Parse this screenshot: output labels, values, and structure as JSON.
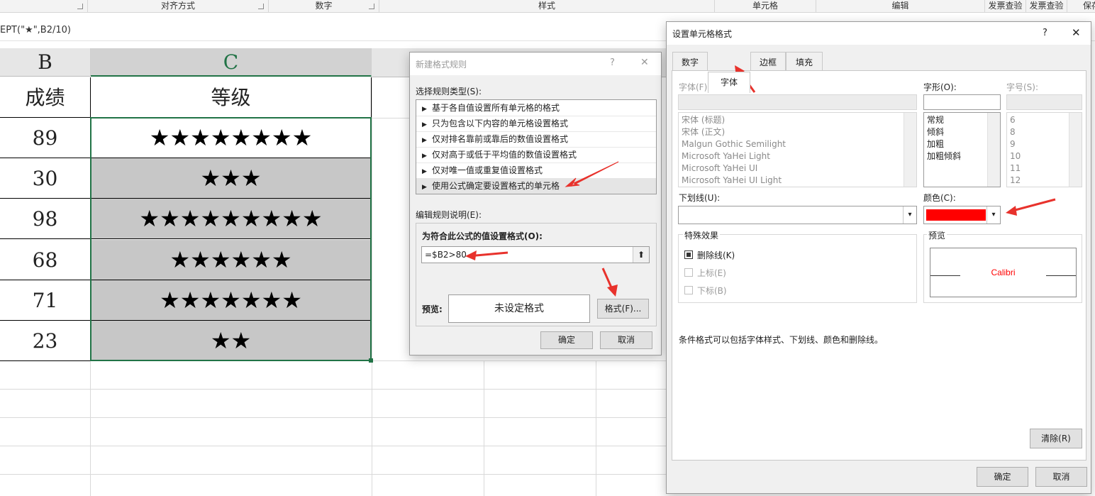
{
  "ribbon": {
    "groups": [
      "对齐方式",
      "数字",
      "样式",
      "单元格",
      "编辑",
      "发票查验",
      "发票查验",
      "保存"
    ]
  },
  "formula_bar": {
    "text": "EPT(\"★\",B2/10)"
  },
  "sheet": {
    "columns": [
      "B",
      "C"
    ],
    "headers": [
      "成绩",
      "等级"
    ],
    "rows": [
      {
        "score": "89",
        "grade": "★★★★★★★★"
      },
      {
        "score": "30",
        "grade": "★★★"
      },
      {
        "score": "98",
        "grade": "★★★★★★★★★"
      },
      {
        "score": "68",
        "grade": "★★★★★★"
      },
      {
        "score": "71",
        "grade": "★★★★★★★"
      },
      {
        "score": "23",
        "grade": "★★"
      }
    ]
  },
  "new_rule_dialog": {
    "title": "新建格式规则",
    "help": "?",
    "close": "✕",
    "rule_type_label": "选择规则类型(S):",
    "rule_types": [
      "基于各自值设置所有单元格的格式",
      "只为包含以下内容的单元格设置格式",
      "仅对排名靠前或靠后的数值设置格式",
      "仅对高于或低于平均值的数值设置格式",
      "仅对唯一值或重复值设置格式",
      "使用公式确定要设置格式的单元格"
    ],
    "selected_rule_index": 5,
    "edit_label": "编辑规则说明(E):",
    "formula_label": "为符合此公式的值设置格式(O):",
    "formula_value": "=$B2>80",
    "preview_label": "预览:",
    "preview_text": "未设定格式",
    "format_button": "格式(F)...",
    "ok": "确定",
    "cancel": "取消"
  },
  "format_cells_dialog": {
    "title": "设置单元格格式",
    "help": "?",
    "close": "✕",
    "tabs": [
      "数字",
      "字体",
      "边框",
      "填充"
    ],
    "active_tab": "字体",
    "font_label": "字体(F):",
    "fonts": [
      "宋体 (标题)",
      "宋体 (正文)",
      "Malgun Gothic Semilight",
      "Microsoft YaHei Light",
      "Microsoft YaHei UI",
      "Microsoft YaHei UI Light"
    ],
    "style_label": "字形(O):",
    "styles": [
      "常规",
      "倾斜",
      "加粗",
      "加粗倾斜"
    ],
    "size_label": "字号(S):",
    "sizes": [
      "6",
      "8",
      "9",
      "10",
      "11",
      "12"
    ],
    "underline_label": "下划线(U):",
    "color_label": "颜色(C):",
    "color_value": "#ff0000",
    "effects_label": "特殊效果",
    "strikethrough": "删除线(K)",
    "superscript": "上标(E)",
    "subscript": "下标(B)",
    "preview_label": "预览",
    "preview_text": "Calibri",
    "note": "条件格式可以包括字体样式、下划线、颜色和删除线。",
    "clear": "清除(R)",
    "ok": "确定",
    "cancel": "取消"
  }
}
